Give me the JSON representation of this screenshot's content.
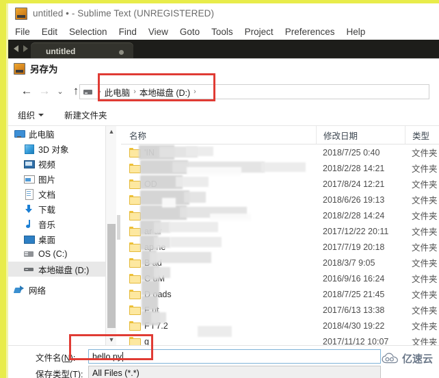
{
  "editor": {
    "title": "untitled • - Sublime Text (UNREGISTERED)",
    "app_icon": "sublime-text-icon",
    "menu": [
      "File",
      "Edit",
      "Selection",
      "Find",
      "View",
      "Goto",
      "Tools",
      "Project",
      "Preferences",
      "Help"
    ],
    "tab": {
      "label": "untitled",
      "dirty_dot": "•"
    },
    "nav": {
      "back": "◀",
      "forward": "▶"
    }
  },
  "dialog": {
    "title": "另存为",
    "icon": "sublime-text-icon",
    "nav": {
      "back": "←",
      "forward": "→",
      "recent": "⌄",
      "up": "↑"
    },
    "address": {
      "drive_icon": "drive-icon",
      "separator": "›",
      "crumbs": [
        "此电脑",
        "本地磁盘 (D:)"
      ]
    },
    "toolbar": {
      "organize": "组织",
      "new_folder": "新建文件夹"
    },
    "sidebar": [
      {
        "label": "此电脑",
        "icon": "computer-icon",
        "indent": false,
        "selected": false
      },
      {
        "label": "3D 对象",
        "icon": "cube-icon",
        "indent": true,
        "selected": false
      },
      {
        "label": "视频",
        "icon": "video-icon",
        "indent": true,
        "selected": false
      },
      {
        "label": "图片",
        "icon": "picture-icon",
        "indent": true,
        "selected": false
      },
      {
        "label": "文档",
        "icon": "document-icon",
        "indent": true,
        "selected": false
      },
      {
        "label": "下载",
        "icon": "download-icon",
        "indent": true,
        "selected": false
      },
      {
        "label": "音乐",
        "icon": "music-icon",
        "indent": true,
        "selected": false
      },
      {
        "label": "桌面",
        "icon": "desktop-icon",
        "indent": true,
        "selected": false
      },
      {
        "label": "OS (C:)",
        "icon": "drive-c-icon",
        "indent": true,
        "selected": false
      },
      {
        "label": "本地磁盘 (D:)",
        "icon": "drive-d-icon",
        "indent": true,
        "selected": true
      },
      {
        "label": "网络",
        "icon": "network-icon",
        "indent": false,
        "selected": false
      }
    ],
    "columns": [
      "名称",
      "修改日期",
      "类型"
    ],
    "rows": [
      {
        "name": "'IN",
        "date": "2018/7/25 0:40",
        "type": "文件夹"
      },
      {
        "name": "",
        "date": "2018/2/28 14:21",
        "type": "文件夹"
      },
      {
        "name": "OD",
        "date": "2017/8/24 12:21",
        "type": "文件夹"
      },
      {
        "name": "",
        "date": "2018/6/26 19:13",
        "type": "文件夹"
      },
      {
        "name": "",
        "date": "2018/2/28 14:24",
        "type": "文件夹"
      },
      {
        "name": "ar     ar",
        "date": "2017/12/22 20:11",
        "type": "文件夹"
      },
      {
        "name": "ap     ne",
        "date": "2017/7/19 20:18",
        "type": "文件夹"
      },
      {
        "name": "B                ad",
        "date": "2018/3/7 9:05",
        "type": "文件夹"
      },
      {
        "name": "C     uM",
        "date": "2016/9/16 16:24",
        "type": "文件夹"
      },
      {
        "name": "D     oads",
        "date": "2018/7/25 21:45",
        "type": "文件夹"
      },
      {
        "name": "F     ut",
        "date": "2017/6/13 13:38",
        "type": "文件夹"
      },
      {
        "name": "F     l 7.2",
        "date": "2018/4/30 19:22",
        "type": "文件夹"
      },
      {
        "name": "g",
        "date": "2017/11/12 10:07",
        "type": "文件夹"
      }
    ],
    "fields": {
      "filename_label": "文件名",
      "filename_accel": "N",
      "filename_value": "hello.py",
      "filetype_label": "保存类型",
      "filetype_accel": "T",
      "filetype_value": "All Files (*.*)"
    }
  },
  "watermark": {
    "text": "亿速云",
    "logo": "cloud-logo"
  },
  "colors": {
    "frame_yellow": "#e8ec4a",
    "annotation_red": "#e03b34",
    "tabbar_dark": "#1d1d1a",
    "field_border_blue": "#7fb3d8"
  }
}
